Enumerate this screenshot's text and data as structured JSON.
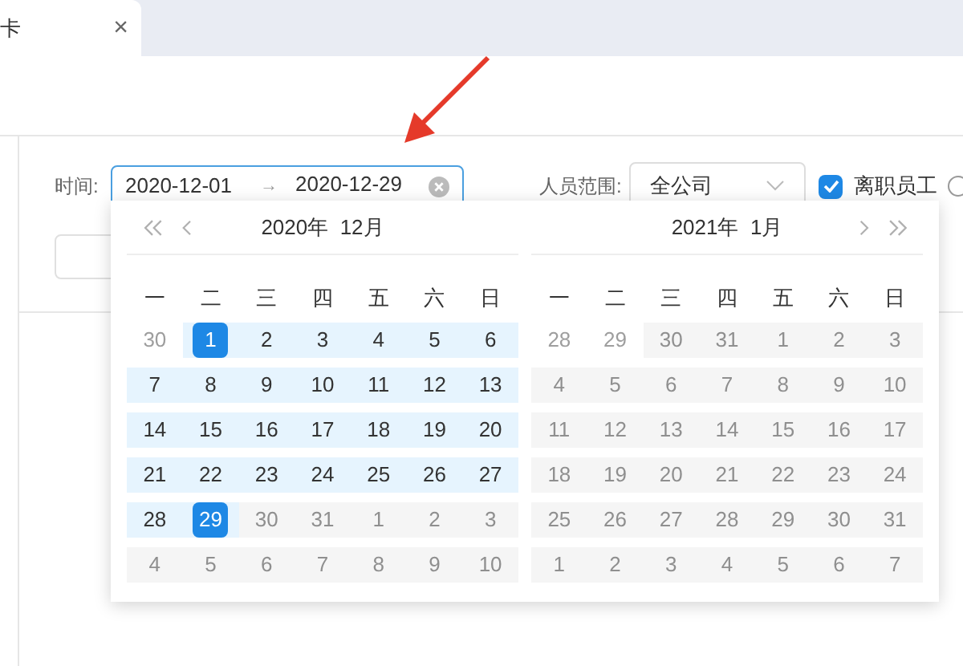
{
  "tab": {
    "label": "卡",
    "close": "×"
  },
  "filter": {
    "time_label": "时间:",
    "start": "2020-12-01",
    "separator": "→",
    "end": "2020-12-29",
    "scope_label": "人员范围:",
    "scope_value": "全公司",
    "resigned": {
      "label": "离职员工",
      "checked": true
    }
  },
  "calendars": [
    {
      "title": "2020年  12月",
      "weekdays": [
        "一",
        "二",
        "三",
        "四",
        "五",
        "六",
        "日"
      ],
      "days": [
        {
          "d": "30",
          "kind": "outside"
        },
        {
          "d": "1",
          "kind": "selected"
        },
        {
          "d": "2",
          "kind": "range"
        },
        {
          "d": "3",
          "kind": "range"
        },
        {
          "d": "4",
          "kind": "range"
        },
        {
          "d": "5",
          "kind": "range"
        },
        {
          "d": "6",
          "kind": "range"
        },
        {
          "d": "7",
          "kind": "range"
        },
        {
          "d": "8",
          "kind": "range"
        },
        {
          "d": "9",
          "kind": "range"
        },
        {
          "d": "10",
          "kind": "range"
        },
        {
          "d": "11",
          "kind": "range"
        },
        {
          "d": "12",
          "kind": "range"
        },
        {
          "d": "13",
          "kind": "range"
        },
        {
          "d": "14",
          "kind": "range"
        },
        {
          "d": "15",
          "kind": "range"
        },
        {
          "d": "16",
          "kind": "range"
        },
        {
          "d": "17",
          "kind": "range"
        },
        {
          "d": "18",
          "kind": "range"
        },
        {
          "d": "19",
          "kind": "range"
        },
        {
          "d": "20",
          "kind": "range"
        },
        {
          "d": "21",
          "kind": "range"
        },
        {
          "d": "22",
          "kind": "range"
        },
        {
          "d": "23",
          "kind": "range"
        },
        {
          "d": "24",
          "kind": "range"
        },
        {
          "d": "25",
          "kind": "range"
        },
        {
          "d": "26",
          "kind": "range"
        },
        {
          "d": "27",
          "kind": "range"
        },
        {
          "d": "28",
          "kind": "range"
        },
        {
          "d": "29",
          "kind": "selected"
        },
        {
          "d": "30",
          "kind": "disabled"
        },
        {
          "d": "31",
          "kind": "disabled"
        },
        {
          "d": "1",
          "kind": "disabled"
        },
        {
          "d": "2",
          "kind": "disabled"
        },
        {
          "d": "3",
          "kind": "disabled"
        },
        {
          "d": "4",
          "kind": "disabled"
        },
        {
          "d": "5",
          "kind": "disabled"
        },
        {
          "d": "6",
          "kind": "disabled"
        },
        {
          "d": "7",
          "kind": "disabled"
        },
        {
          "d": "8",
          "kind": "disabled"
        },
        {
          "d": "9",
          "kind": "disabled"
        },
        {
          "d": "10",
          "kind": "disabled"
        }
      ]
    },
    {
      "title": "2021年  1月",
      "weekdays": [
        "一",
        "二",
        "三",
        "四",
        "五",
        "六",
        "日"
      ],
      "days": [
        {
          "d": "28",
          "kind": "outside"
        },
        {
          "d": "29",
          "kind": "outside"
        },
        {
          "d": "30",
          "kind": "disabled"
        },
        {
          "d": "31",
          "kind": "disabled"
        },
        {
          "d": "1",
          "kind": "disabled"
        },
        {
          "d": "2",
          "kind": "disabled"
        },
        {
          "d": "3",
          "kind": "disabled"
        },
        {
          "d": "4",
          "kind": "disabled"
        },
        {
          "d": "5",
          "kind": "disabled"
        },
        {
          "d": "6",
          "kind": "disabled"
        },
        {
          "d": "7",
          "kind": "disabled"
        },
        {
          "d": "8",
          "kind": "disabled"
        },
        {
          "d": "9",
          "kind": "disabled"
        },
        {
          "d": "10",
          "kind": "disabled"
        },
        {
          "d": "11",
          "kind": "disabled"
        },
        {
          "d": "12",
          "kind": "disabled"
        },
        {
          "d": "13",
          "kind": "disabled"
        },
        {
          "d": "14",
          "kind": "disabled"
        },
        {
          "d": "15",
          "kind": "disabled"
        },
        {
          "d": "16",
          "kind": "disabled"
        },
        {
          "d": "17",
          "kind": "disabled"
        },
        {
          "d": "18",
          "kind": "disabled"
        },
        {
          "d": "19",
          "kind": "disabled"
        },
        {
          "d": "20",
          "kind": "disabled"
        },
        {
          "d": "21",
          "kind": "disabled"
        },
        {
          "d": "22",
          "kind": "disabled"
        },
        {
          "d": "23",
          "kind": "disabled"
        },
        {
          "d": "24",
          "kind": "disabled"
        },
        {
          "d": "25",
          "kind": "disabled"
        },
        {
          "d": "26",
          "kind": "disabled"
        },
        {
          "d": "27",
          "kind": "disabled"
        },
        {
          "d": "28",
          "kind": "disabled"
        },
        {
          "d": "29",
          "kind": "disabled"
        },
        {
          "d": "30",
          "kind": "disabled"
        },
        {
          "d": "31",
          "kind": "disabled"
        },
        {
          "d": "1",
          "kind": "disabled"
        },
        {
          "d": "2",
          "kind": "disabled"
        },
        {
          "d": "3",
          "kind": "disabled"
        },
        {
          "d": "4",
          "kind": "disabled"
        },
        {
          "d": "5",
          "kind": "disabled"
        },
        {
          "d": "6",
          "kind": "disabled"
        },
        {
          "d": "7",
          "kind": "disabled"
        }
      ]
    }
  ]
}
